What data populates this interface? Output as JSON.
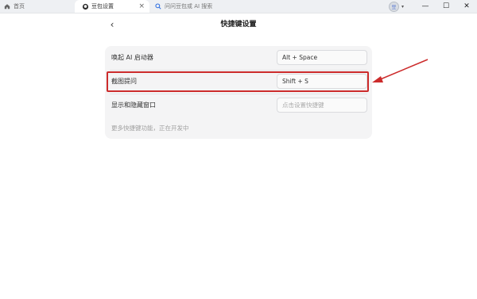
{
  "tabs": [
    {
      "label": "首页",
      "icon": "home-icon"
    },
    {
      "label": "豆包设置",
      "icon": "doubao-icon",
      "active": true
    },
    {
      "label": "问问豆包或 AI 搜索",
      "icon": "search-icon"
    }
  ],
  "window": {
    "avatar_letter": "豆"
  },
  "header": {
    "title": "快捷键设置",
    "back_icon": "back-arrow-icon"
  },
  "shortcuts": [
    {
      "label": "唤起 AI 启动器",
      "value": "Alt + Space",
      "placeholder": ""
    },
    {
      "label": "截图提问",
      "value": "Shift + S",
      "placeholder": ""
    },
    {
      "label": "显示和隐藏窗口",
      "value": "",
      "placeholder": "点击设置快捷键"
    }
  ],
  "footnote": "更多快捷键功能，正在开发中",
  "annotation": {
    "highlight_color": "#cc2b2b",
    "target": "截图提问"
  }
}
